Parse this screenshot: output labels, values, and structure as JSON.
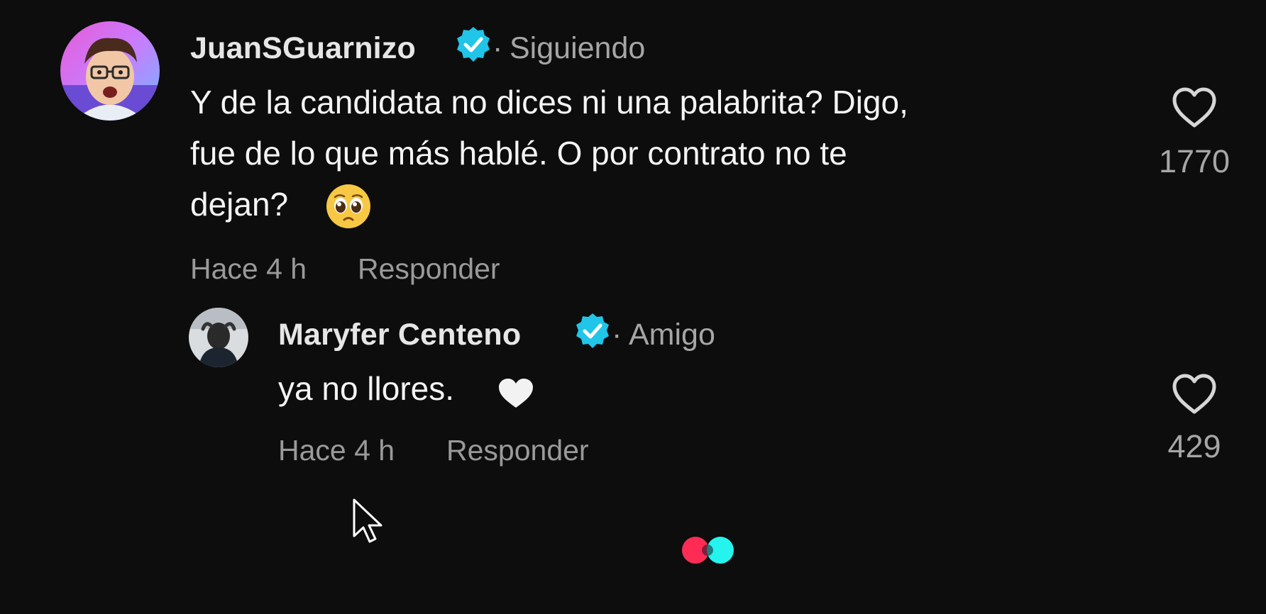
{
  "comments": [
    {
      "username": "JuanSGuarnizo",
      "verified": true,
      "relation_sep": "·",
      "relation": "Siguiendo",
      "lines": [
        "Y de la candidata no dices ni una palabrita? Digo,",
        "fue de lo que más hablé. O por contrato no te",
        "dejan?"
      ],
      "emoji": "pleading-face-emoji",
      "time": "Hace 4 h",
      "reply_label": "Responder",
      "like_icon": "heart-outline-icon",
      "likes": "1770"
    },
    {
      "username": "Maryfer Centeno",
      "verified": true,
      "relation_sep": "·",
      "relation": "Amigo",
      "text": "ya no llores.",
      "emoji": "white-heart-emoji",
      "time": "Hace 4 h",
      "reply_label": "Responder",
      "like_icon": "heart-outline-icon",
      "likes": "429"
    }
  ],
  "colors": {
    "background": "#0d0d0d",
    "verified_badge": "#20c5e8",
    "loader_red": "#fe2c55",
    "loader_cyan": "#25f4ee"
  }
}
